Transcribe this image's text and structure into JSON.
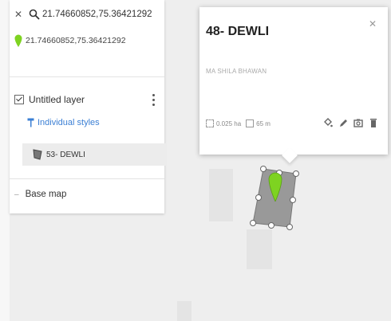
{
  "search": {
    "close_icon": "close-icon",
    "search_icon": "search-icon",
    "query": "21.74660852,75.36421292"
  },
  "search_result": {
    "pin_icon": "map-pin-icon",
    "pin_color": "#7ed321",
    "coordinates": "21.74660852,75.36421292"
  },
  "layer": {
    "checkbox_icon": "checkbox-checked-icon",
    "title": "Untitled layer",
    "menu_icon": "more-vert-icon",
    "styles_icon": "paint-roller-icon",
    "styles_label": "Individual styles",
    "styles_color": "#3b7fd4",
    "feature_icon": "polygon-icon",
    "feature_label": "53- DEWLI"
  },
  "basemap": {
    "collapse_icon": "collapse-icon",
    "label": "Base map"
  },
  "popup": {
    "title": "48- DEWLI",
    "close_icon": "close-icon",
    "description": "MA SHILA BHAWAN",
    "area_icon": "area-icon",
    "area": "0.025 ha",
    "perimeter_icon": "perimeter-icon",
    "perimeter": "65 m",
    "actions": {
      "style_icon": "paint-bucket-icon",
      "edit_icon": "pencil-icon",
      "photo_icon": "camera-icon",
      "delete_icon": "trash-icon"
    }
  },
  "map": {
    "polygon_fill": "#999999",
    "pin_color": "#7ed321"
  }
}
